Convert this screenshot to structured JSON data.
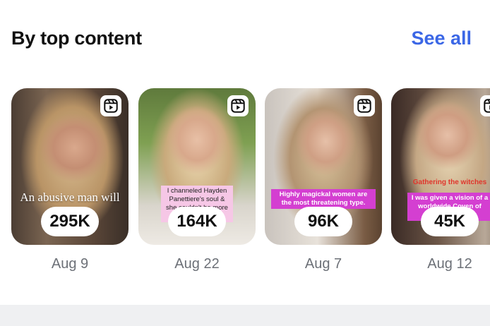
{
  "section": {
    "title": "By top content",
    "see_all": "See all"
  },
  "cards": [
    {
      "date": "Aug 9",
      "views": "295K",
      "caption": "An abusive man will wa...",
      "caption_style": "serif",
      "icon": "reels-icon"
    },
    {
      "date": "Aug 22",
      "views": "164K",
      "caption": "I channeled Hayden Panettiere's soul & she couldn't be more clear",
      "caption_style": "pink",
      "icon": "reels-icon"
    },
    {
      "date": "Aug 7",
      "views": "96K",
      "caption": "Highly magickal women are the most threatening type.",
      "caption_style": "magenta",
      "icon": "reels-icon"
    },
    {
      "date": "Aug 12",
      "views": "45K",
      "caption_top": "Gathering the witches",
      "caption": "I was given a vision of a worldwide Coven of women wa...",
      "caption_style": "magenta",
      "icon": "reels-icon"
    }
  ],
  "colors": {
    "accent": "#3b67e6",
    "caption_magenta": "#d43fd1",
    "caption_pink": "#f6c7e6",
    "caption_red": "#e0352b"
  }
}
